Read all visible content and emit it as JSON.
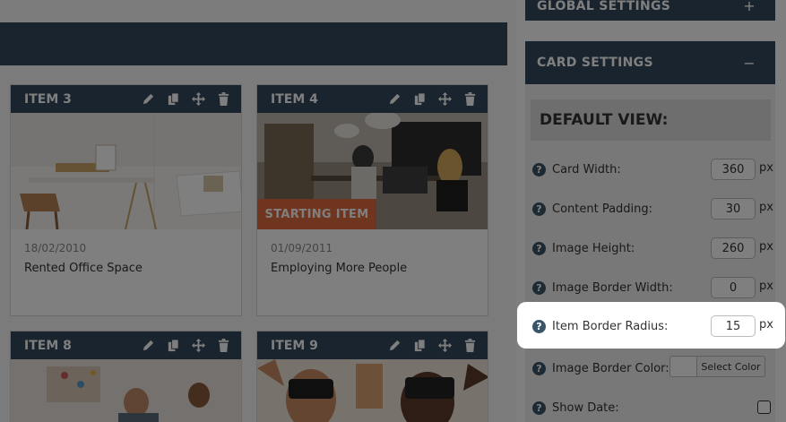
{
  "panels": {
    "global_settings": {
      "title": "GLOBAL SETTINGS",
      "toggle": "+"
    },
    "card_settings": {
      "title": "CARD SETTINGS",
      "toggle": "−"
    }
  },
  "default_view": {
    "title": "DEFAULT VIEW:"
  },
  "settings": [
    {
      "label": "Card Width:",
      "value": "360",
      "unit": "px"
    },
    {
      "label": "Content Padding:",
      "value": "30",
      "unit": "px"
    },
    {
      "label": "Image Height:",
      "value": "260",
      "unit": "px"
    },
    {
      "label": "Image Border Width:",
      "value": "0",
      "unit": "px"
    },
    {
      "label": "Item Border Radius:",
      "value": "15",
      "unit": "px"
    },
    {
      "label": "Image Border Color:",
      "button": "Select Color"
    },
    {
      "label": "Show Date:",
      "checked": false
    }
  ],
  "help_icon": {
    "glyph": "?"
  },
  "items": [
    {
      "title": "ITEM 3",
      "date": "18/02/2010",
      "name": "Rented Office Space"
    },
    {
      "title": "ITEM 4",
      "date": "01/09/2011",
      "name": "Employing More People",
      "badge": "STARTING ITEM"
    },
    {
      "title": "ITEM 8"
    },
    {
      "title": "ITEM 9"
    }
  ],
  "colors": {
    "header": "#33485c",
    "badge": "#e06a3c",
    "overlay": "rgba(0,0,0,0.5)"
  },
  "icons": [
    "pencil-icon",
    "copy-icon",
    "move-icon",
    "trash-icon",
    "help-icon"
  ]
}
